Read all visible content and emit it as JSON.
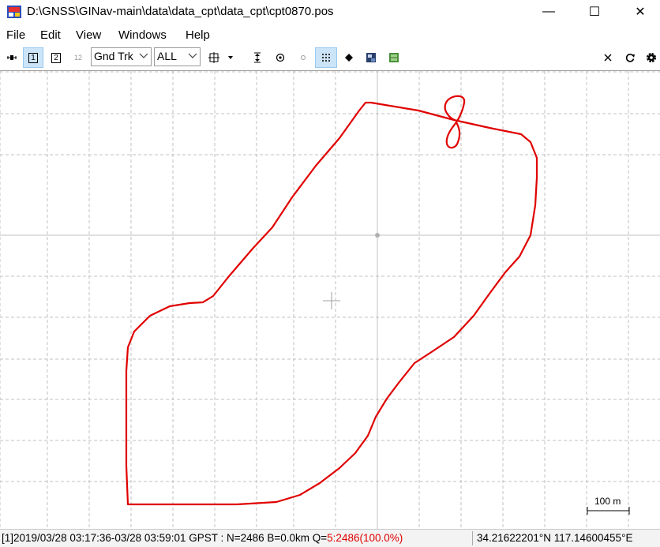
{
  "window": {
    "title": "D:\\GNSS\\GINav-main\\data\\data_cpt\\data_cpt\\cpt0870.pos",
    "minimize_glyph": "—",
    "maximize_glyph": "☐",
    "close_glyph": "✕"
  },
  "menu": {
    "items": [
      "File",
      "Edit",
      "View",
      "Windows",
      "Help"
    ]
  },
  "toolbar": {
    "btn1": "1",
    "btn2": "2",
    "btn12": "12",
    "plot_type": "Gnd Trk",
    "quality_filter": "ALL",
    "icons": [
      "ruler-icon",
      "solution1-icon",
      "solution2-icon",
      "solution12-icon",
      "center-origin-icon",
      "fit-vertical-icon",
      "center-point-icon",
      "point-icon",
      "grid-icon",
      "marker-icon",
      "map-image-icon",
      "sky-image-icon",
      "clear-icon",
      "reload-icon",
      "settings-icon"
    ]
  },
  "plot": {
    "scale_label": "100 m",
    "track_color": "#e00000",
    "grid_color": "#c0c0c0"
  },
  "status": {
    "left": "[1]2019/03/28 03:17:36-03/28 03:59:01 GPST : N=2486 B=0.0km Q=",
    "quality": "5:2486(100.0%)",
    "right": "34.21622201°N  117.14600455°E"
  }
}
